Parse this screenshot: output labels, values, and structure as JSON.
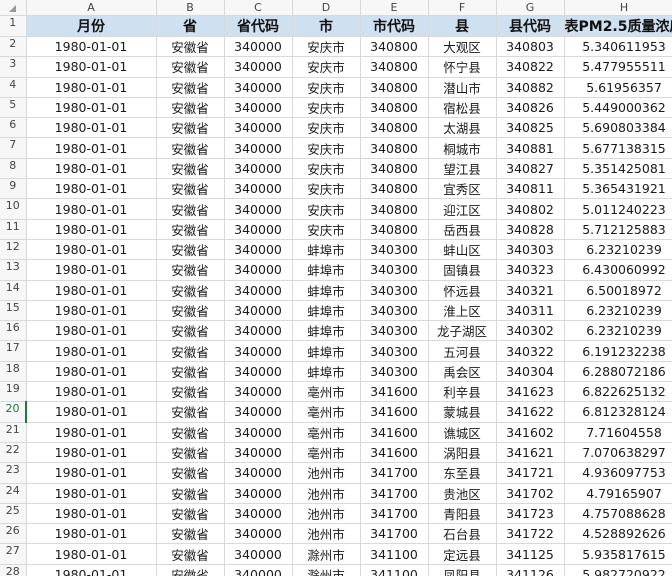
{
  "columns": [
    "A",
    "B",
    "C",
    "D",
    "E",
    "F",
    "G",
    "H"
  ],
  "header": {
    "row_number": "1",
    "cells": [
      "月份",
      "省",
      "省代码",
      "市",
      "市代码",
      "县",
      "县代码",
      "表PM2.5质量浓度"
    ]
  },
  "active_row": "20",
  "rows": [
    {
      "n": "2",
      "c": [
        "1980-01-01",
        "安徽省",
        "340000",
        "安庆市",
        "340800",
        "大观区",
        "340803",
        "5.340611953"
      ]
    },
    {
      "n": "3",
      "c": [
        "1980-01-01",
        "安徽省",
        "340000",
        "安庆市",
        "340800",
        "怀宁县",
        "340822",
        "5.477955511"
      ]
    },
    {
      "n": "4",
      "c": [
        "1980-01-01",
        "安徽省",
        "340000",
        "安庆市",
        "340800",
        "潜山市",
        "340882",
        "5.61956357"
      ]
    },
    {
      "n": "5",
      "c": [
        "1980-01-01",
        "安徽省",
        "340000",
        "安庆市",
        "340800",
        "宿松县",
        "340826",
        "5.449000362"
      ]
    },
    {
      "n": "6",
      "c": [
        "1980-01-01",
        "安徽省",
        "340000",
        "安庆市",
        "340800",
        "太湖县",
        "340825",
        "5.690803384"
      ]
    },
    {
      "n": "7",
      "c": [
        "1980-01-01",
        "安徽省",
        "340000",
        "安庆市",
        "340800",
        "桐城市",
        "340881",
        "5.677138315"
      ]
    },
    {
      "n": "8",
      "c": [
        "1980-01-01",
        "安徽省",
        "340000",
        "安庆市",
        "340800",
        "望江县",
        "340827",
        "5.351425081"
      ]
    },
    {
      "n": "9",
      "c": [
        "1980-01-01",
        "安徽省",
        "340000",
        "安庆市",
        "340800",
        "宜秀区",
        "340811",
        "5.365431921"
      ]
    },
    {
      "n": "10",
      "c": [
        "1980-01-01",
        "安徽省",
        "340000",
        "安庆市",
        "340800",
        "迎江区",
        "340802",
        "5.011240223"
      ]
    },
    {
      "n": "11",
      "c": [
        "1980-01-01",
        "安徽省",
        "340000",
        "安庆市",
        "340800",
        "岳西县",
        "340828",
        "5.712125883"
      ]
    },
    {
      "n": "12",
      "c": [
        "1980-01-01",
        "安徽省",
        "340000",
        "蚌埠市",
        "340300",
        "蚌山区",
        "340303",
        "6.23210239"
      ]
    },
    {
      "n": "13",
      "c": [
        "1980-01-01",
        "安徽省",
        "340000",
        "蚌埠市",
        "340300",
        "固镇县",
        "340323",
        "6.430060992"
      ]
    },
    {
      "n": "14",
      "c": [
        "1980-01-01",
        "安徽省",
        "340000",
        "蚌埠市",
        "340300",
        "怀远县",
        "340321",
        "6.50018972"
      ]
    },
    {
      "n": "15",
      "c": [
        "1980-01-01",
        "安徽省",
        "340000",
        "蚌埠市",
        "340300",
        "淮上区",
        "340311",
        "6.23210239"
      ]
    },
    {
      "n": "16",
      "c": [
        "1980-01-01",
        "安徽省",
        "340000",
        "蚌埠市",
        "340300",
        "龙子湖区",
        "340302",
        "6.23210239"
      ]
    },
    {
      "n": "17",
      "c": [
        "1980-01-01",
        "安徽省",
        "340000",
        "蚌埠市",
        "340300",
        "五河县",
        "340322",
        "6.191232238"
      ]
    },
    {
      "n": "18",
      "c": [
        "1980-01-01",
        "安徽省",
        "340000",
        "蚌埠市",
        "340300",
        "禹会区",
        "340304",
        "6.288072186"
      ]
    },
    {
      "n": "19",
      "c": [
        "1980-01-01",
        "安徽省",
        "340000",
        "亳州市",
        "341600",
        "利辛县",
        "341623",
        "6.822625132"
      ]
    },
    {
      "n": "20",
      "c": [
        "1980-01-01",
        "安徽省",
        "340000",
        "亳州市",
        "341600",
        "蒙城县",
        "341622",
        "6.812328124"
      ]
    },
    {
      "n": "21",
      "c": [
        "1980-01-01",
        "安徽省",
        "340000",
        "亳州市",
        "341600",
        "谯城区",
        "341602",
        "7.71604558"
      ]
    },
    {
      "n": "22",
      "c": [
        "1980-01-01",
        "安徽省",
        "340000",
        "亳州市",
        "341600",
        "涡阳县",
        "341621",
        "7.070638297"
      ]
    },
    {
      "n": "23",
      "c": [
        "1980-01-01",
        "安徽省",
        "340000",
        "池州市",
        "341700",
        "东至县",
        "341721",
        "4.936097753"
      ]
    },
    {
      "n": "24",
      "c": [
        "1980-01-01",
        "安徽省",
        "340000",
        "池州市",
        "341700",
        "贵池区",
        "341702",
        "4.79165907"
      ]
    },
    {
      "n": "25",
      "c": [
        "1980-01-01",
        "安徽省",
        "340000",
        "池州市",
        "341700",
        "青阳县",
        "341723",
        "4.757088628"
      ]
    },
    {
      "n": "26",
      "c": [
        "1980-01-01",
        "安徽省",
        "340000",
        "池州市",
        "341700",
        "石台县",
        "341722",
        "4.528892626"
      ]
    },
    {
      "n": "27",
      "c": [
        "1980-01-01",
        "安徽省",
        "340000",
        "滁州市",
        "341100",
        "定远县",
        "341125",
        "5.935817615"
      ]
    },
    {
      "n": "28",
      "c": [
        "1980-01-01",
        "安徽省",
        "340000",
        "滁州市",
        "341100",
        "凤阳县",
        "341126",
        "5.982720922"
      ]
    }
  ]
}
